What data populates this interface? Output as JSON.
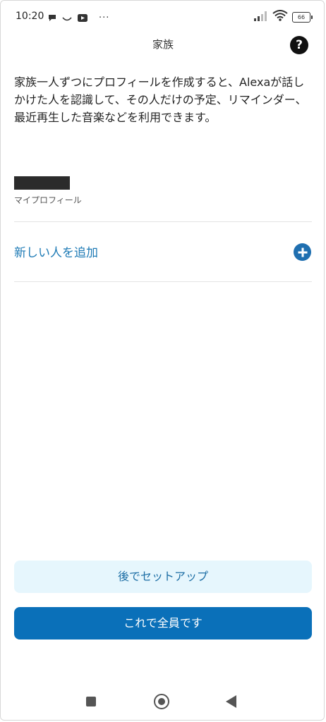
{
  "status_bar": {
    "time": "10:20",
    "left_icons": [
      "chat-bubble-icon",
      "smile-icon",
      "youtube-icon",
      "more-dots-icon"
    ],
    "more": "···",
    "battery": "66",
    "right_icons": [
      "signal-icon",
      "wifi-icon",
      "battery-icon"
    ]
  },
  "header": {
    "title": "家族",
    "help": "?"
  },
  "description": "家族一人ずつにプロフィールを作成すると、Alexaが話しかけた人を認識して、その人だけの予定、リマインダー、最近再生した音楽などを利用できます。",
  "profile": {
    "name": "",
    "caption": "マイプロフィール"
  },
  "add_person": {
    "label": "新しい人を追加",
    "icon": "plus-circle-icon",
    "accent": "#1d7ab5"
  },
  "buttons": {
    "later": "後でセットアップ",
    "done": "これで全員です"
  },
  "colors": {
    "primary": "#0a70b9",
    "secondary_bg": "#e6f6fd"
  },
  "nav_bar": {
    "items": [
      "recent-apps-icon",
      "home-icon",
      "back-icon"
    ]
  }
}
